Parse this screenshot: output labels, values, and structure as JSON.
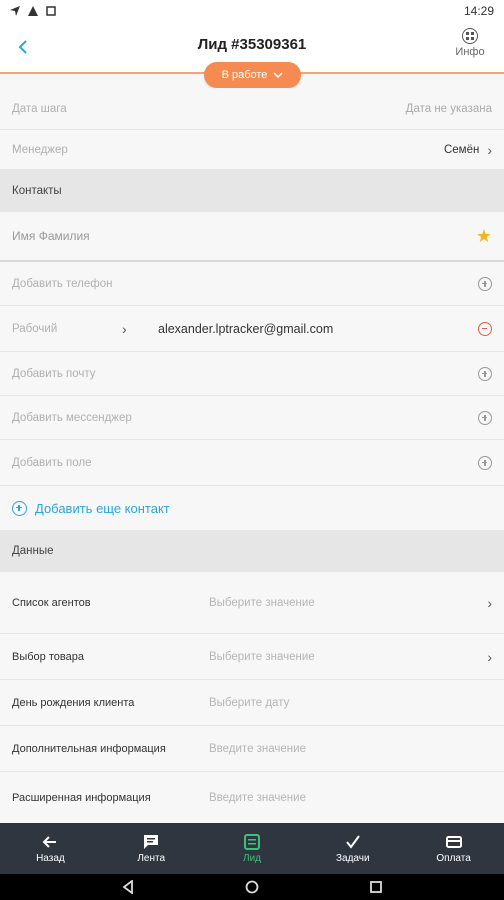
{
  "status_bar": {
    "time": "14:29"
  },
  "header": {
    "title": "Лид #35309361",
    "info_label": "Инфо",
    "status": "В работе"
  },
  "fields_top": [
    {
      "label": "Дата шага",
      "value": "Дата не указана"
    },
    {
      "label": "Менеджер",
      "value": "Семён"
    }
  ],
  "contacts": {
    "section_title": "Контакты",
    "name_placeholder": "Имя Фамилия",
    "add_phone": "Добавить телефон",
    "work_label": "Рабочий",
    "work_email": "alexander.lptracker@gmail.com",
    "add_email": "Добавить почту",
    "add_messenger": "Добавить мессенджер",
    "add_field": "Добавить поле",
    "add_contact": "Добавить еще контакт"
  },
  "data_section": {
    "section_title": "Данные",
    "fields": [
      {
        "label": "Список агентов",
        "placeholder": "Выберите значение"
      },
      {
        "label": "Выбор товара",
        "placeholder": "Выберите значение"
      },
      {
        "label": "День рождения клиента",
        "placeholder": "Выберите дату"
      },
      {
        "label": "Дополнительная информация",
        "placeholder": "Введите значение"
      },
      {
        "label": "Расширенная информация",
        "placeholder": "Введите значение"
      }
    ]
  },
  "bottom_nav": [
    {
      "label": "Назад",
      "icon": "arrow-left-icon"
    },
    {
      "label": "Лента",
      "icon": "chat-icon"
    },
    {
      "label": "Лид",
      "icon": "list-icon",
      "active": true
    },
    {
      "label": "Задачи",
      "icon": "check-icon"
    },
    {
      "label": "Оплата",
      "icon": "card-icon"
    }
  ],
  "colors": {
    "accent": "#f58b50",
    "link": "#2aa5e0",
    "active_nav": "#3bc07a",
    "nav_bg": "#2f3640",
    "star": "#f2b51d",
    "remove": "#e65a4a"
  }
}
